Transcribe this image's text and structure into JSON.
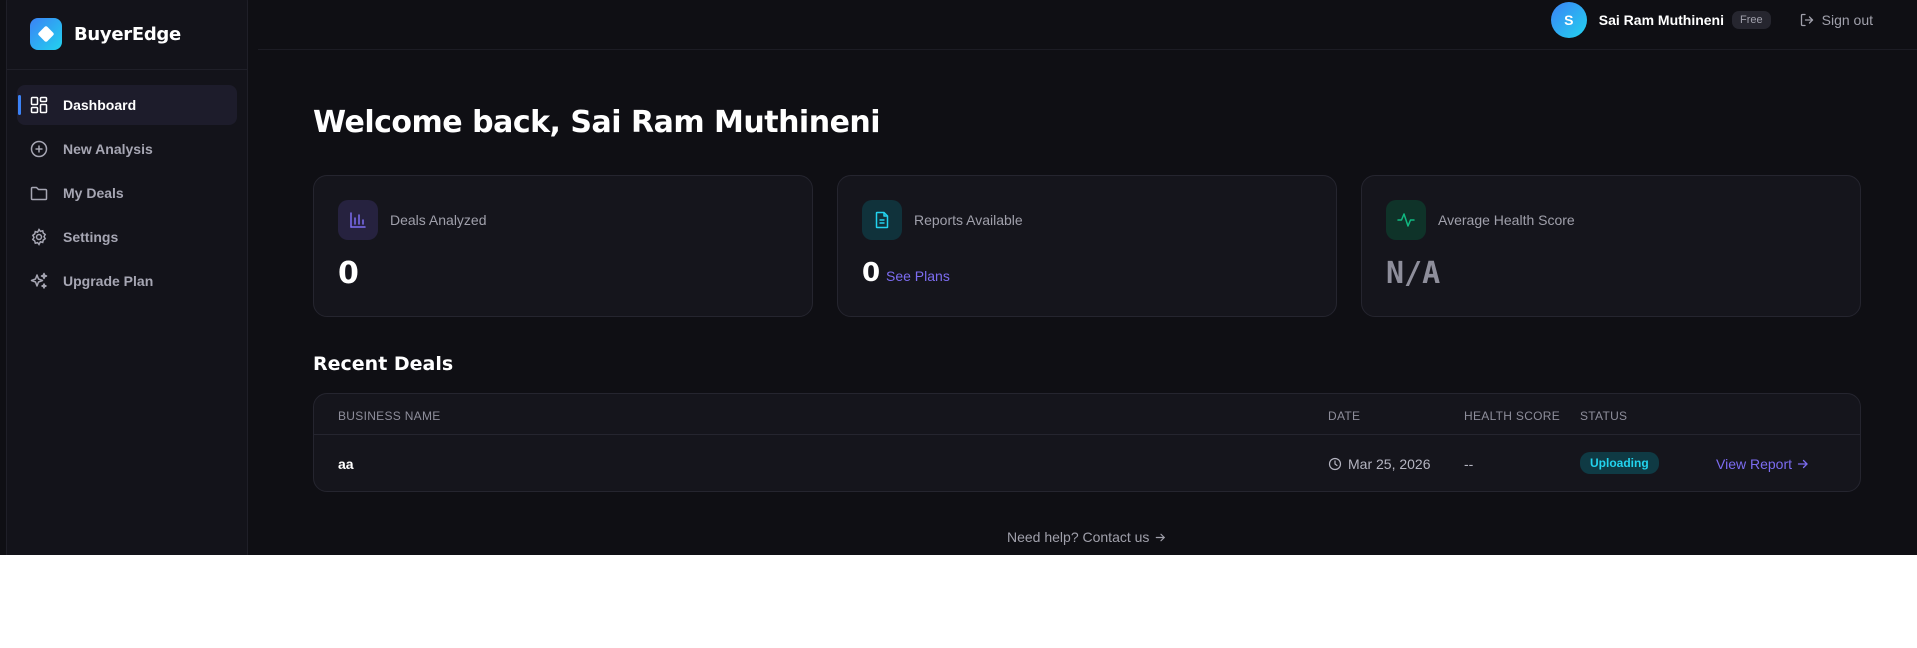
{
  "brand": {
    "name": "BuyerEdge"
  },
  "sidebar": {
    "items": [
      {
        "label": "Dashboard",
        "icon": "dashboard-icon",
        "active": true
      },
      {
        "label": "New Analysis",
        "icon": "plus-circle-icon"
      },
      {
        "label": "My Deals",
        "icon": "folder-icon"
      },
      {
        "label": "Settings",
        "icon": "gear-icon"
      },
      {
        "label": "Upgrade Plan",
        "icon": "sparkles-icon"
      }
    ]
  },
  "header": {
    "avatar_initial": "S",
    "user_name": "Sai Ram Muthineni",
    "plan": "Free",
    "signout_label": "Sign out"
  },
  "main": {
    "welcome": "Welcome back, Sai Ram Muthineni",
    "cards": [
      {
        "label": "Deals Analyzed",
        "value": "0",
        "icon": "bar-chart-icon",
        "accent": "#7c6cf0"
      },
      {
        "label": "Reports Available",
        "value": "0",
        "link": "See Plans",
        "icon": "document-icon",
        "accent": "#22d3ee"
      },
      {
        "label": "Average Health Score",
        "value": "N/A",
        "icon": "activity-icon",
        "accent": "#10b981"
      }
    ],
    "recent_title": "Recent Deals",
    "table": {
      "columns": [
        "BUSINESS NAME",
        "DATE",
        "HEALTH SCORE",
        "STATUS"
      ],
      "rows": [
        {
          "name": "aa",
          "date": "Mar 25, 2026",
          "health": "--",
          "status": "Uploading",
          "action": "View Report"
        }
      ]
    },
    "help": "Need help? Contact us"
  }
}
